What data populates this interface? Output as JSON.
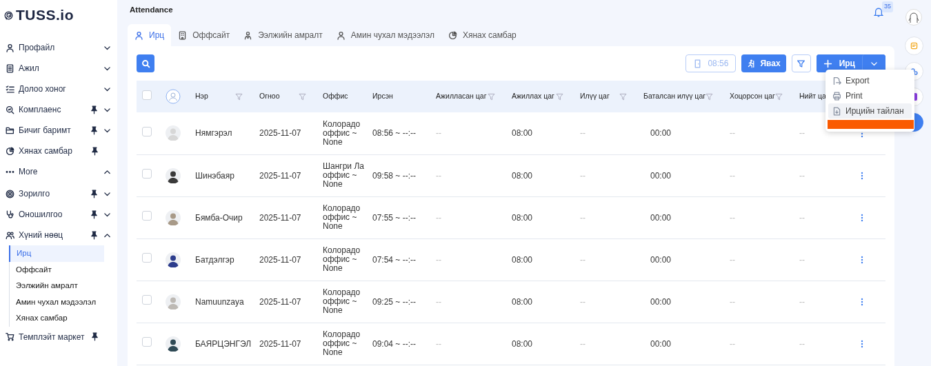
{
  "logo": {
    "text": "TUSS.io"
  },
  "sidebar": {
    "items": [
      {
        "label": "Профайл",
        "pinned": false,
        "expanded": false
      },
      {
        "label": "Ажил",
        "pinned": false,
        "expanded": false
      },
      {
        "label": "Долоо хоног",
        "pinned": false,
        "expanded": false
      },
      {
        "label": "Комплаенс",
        "pinned": true,
        "expanded": false
      },
      {
        "label": "Бичиг баримт",
        "pinned": true,
        "expanded": false
      },
      {
        "label": "Хянах самбар",
        "pinned": true
      },
      {
        "label": "More",
        "pinned": false,
        "expanded": true
      },
      {
        "label": "Зорилго",
        "pinned": true,
        "expanded": false
      },
      {
        "label": "Оношилгоо",
        "pinned": true,
        "expanded": false
      },
      {
        "label": "Хүний нөөц",
        "pinned": true,
        "expanded": true,
        "children": [
          {
            "label": "Ирц",
            "selected": true
          },
          {
            "label": "Оффсайт",
            "selected": false
          },
          {
            "label": "Ээлжийн амралт",
            "selected": false
          },
          {
            "label": "Амин чухал мэдээлэл",
            "selected": false
          },
          {
            "label": "Хянах самбар",
            "selected": false
          }
        ]
      },
      {
        "label": "Темплэйт маркет",
        "pinned": true
      }
    ]
  },
  "header": {
    "title": "Attendance",
    "notifications": "35"
  },
  "tabs": [
    {
      "label": "Ирц",
      "selected": true
    },
    {
      "label": "Оффсайт",
      "selected": false
    },
    {
      "label": "Ээлжийн амралт",
      "selected": false
    },
    {
      "label": "Амин чухал мэдээлэл",
      "selected": false
    },
    {
      "label": "Хянах самбар",
      "selected": false
    }
  ],
  "toolbar": {
    "clock_in": {
      "time": "08:56",
      "disabled": true
    },
    "leave_button": "Явах",
    "add_button": "Ирц"
  },
  "menu": {
    "items": [
      {
        "label": "Export",
        "highlighted": false
      },
      {
        "label": "Print",
        "highlighted": false
      },
      {
        "label": "Ирцийн тайлан",
        "highlighted": true
      }
    ]
  },
  "table": {
    "select_all": {
      "checked": false
    },
    "columns": [
      {
        "label": "Нэр",
        "filter": true
      },
      {
        "label": "Огноо",
        "filter": true
      },
      {
        "label": "Оффис",
        "filter": false
      },
      {
        "label": "Ирсэн",
        "filter": false
      },
      {
        "label": "Ажилласан цаг",
        "filter": true
      },
      {
        "label": "Ажиллах цаг",
        "filter": true
      },
      {
        "label": "Илүү цаг",
        "filter": true
      },
      {
        "label": "Баталсан илүү цаг",
        "filter": true
      },
      {
        "label": "Хоцорсон цаг",
        "filter": true
      },
      {
        "label": "Нийт ца",
        "filter": false
      }
    ],
    "rows": [
      {
        "checked": false,
        "cells": [
          "Нямгэрэл",
          "2025-11-07",
          "Колорадо оффис ~ None",
          "08:56 ~ --:--",
          "--",
          "08:00",
          "--",
          "00:00",
          "--",
          "--"
        ]
      },
      {
        "checked": false,
        "cells": [
          "Шинэбаяр",
          "2025-11-07",
          "Шангри Ла оффис ~ None",
          "09:58 ~ --:--",
          "--",
          "08:00",
          "--",
          "00:00",
          "--",
          "--"
        ]
      },
      {
        "checked": false,
        "cells": [
          "Бямба-Очир",
          "2025-11-07",
          "Колорадо оффис ~ None",
          "07:55 ~ --:--",
          "--",
          "08:00",
          "--",
          "00:00",
          "--",
          "--"
        ]
      },
      {
        "checked": false,
        "cells": [
          "Батдэлгэр",
          "2025-11-07",
          "Колорадо оффис ~ None",
          "07:54 ~ --:--",
          "--",
          "08:00",
          "--",
          "00:00",
          "--",
          "--"
        ]
      },
      {
        "checked": false,
        "cells": [
          "Namuunzaya",
          "2025-11-07",
          "Колорадо оффис ~ None",
          "09:25 ~ --:--",
          "--",
          "08:00",
          "--",
          "00:00",
          "--",
          "--"
        ]
      },
      {
        "checked": false,
        "cells": [
          "БАЯРЦЭНГЭЛ",
          "2025-11-07",
          "Колорадо оффис ~ None",
          "09:04 ~ --:--",
          "--",
          "08:00",
          "--",
          "00:00",
          "--",
          "--"
        ]
      }
    ]
  }
}
